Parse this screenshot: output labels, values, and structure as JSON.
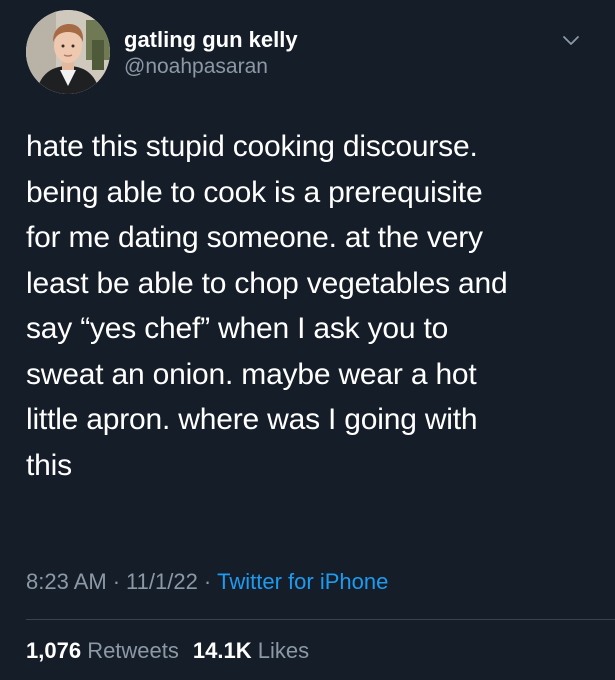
{
  "tweet": {
    "author": {
      "display_name": "gatling gun kelly",
      "handle": "@noahpasaran",
      "avatar_icon": "profile-photo"
    },
    "menu_icon": "chevron-down-icon",
    "text": "hate this stupid cooking discourse.\nbeing able to cook is a prerequisite\nfor me dating someone. at the very\nleast be able to chop vegetables and\nsay “yes chef” when I ask you to\nsweat an onion. maybe wear a hot\nlittle apron. where was I going with\nthis",
    "time": "8:23 AM",
    "separator": "·",
    "date": "11/1/22",
    "source": "Twitter for iPhone",
    "retweets": {
      "count": "1,076",
      "label": "Retweets"
    },
    "likes": {
      "count": "14.1K",
      "label": "Likes"
    }
  },
  "colors": {
    "background": "#151d29",
    "primary_text": "#ffffff",
    "secondary_text": "#8b98a5",
    "link": "#1d9bf0",
    "divider": "#38444d"
  }
}
